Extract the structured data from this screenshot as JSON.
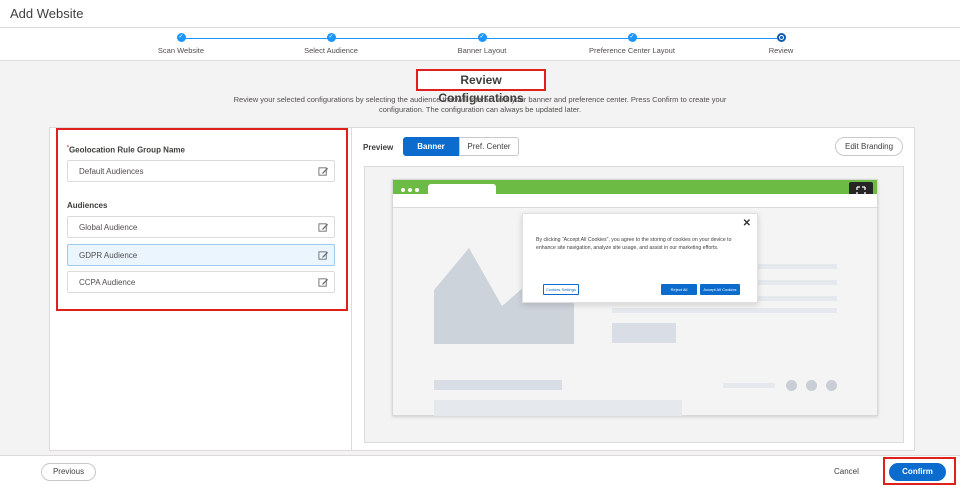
{
  "window": {
    "title": "Add Website"
  },
  "stepper": {
    "steps": [
      {
        "label": "Scan Website",
        "state": "complete"
      },
      {
        "label": "Select Audience",
        "state": "complete"
      },
      {
        "label": "Banner Layout",
        "state": "complete"
      },
      {
        "label": "Preference Center Layout",
        "state": "complete"
      },
      {
        "label": "Review",
        "state": "current"
      }
    ],
    "accent": "#1b96ff"
  },
  "review": {
    "title": "Review Configurations",
    "description": "Review your selected configurations by selecting the audience that will interact with your banner and preference center. Press Confirm to create your configuration. The configuration can always be updated later."
  },
  "left_panel": {
    "required_mark": "*",
    "group_label": "Geolocation Rule Group Name",
    "group_value": "Default Audiences",
    "audiences_label": "Audiences",
    "audiences": [
      {
        "label": "Global Audience",
        "selected": false
      },
      {
        "label": "GDPR Audience",
        "selected": true
      },
      {
        "label": "CCPA Audience",
        "selected": false
      }
    ],
    "edit_icon": "edit-icon"
  },
  "preview": {
    "label": "Preview",
    "tabs": [
      {
        "label": "Banner",
        "active": true
      },
      {
        "label": "Pref. Center",
        "active": false
      }
    ],
    "edit_branding": "Edit Branding",
    "browser_bar_color": "#6cbb45",
    "banner": {
      "close": "✕",
      "text": "By clicking “Accept All Cookies”, you agree to the storing of cookies on your device to enhance site navigation, analyze site usage, and assist in our marketing efforts.",
      "settings_button": "Cookies Settings",
      "reject_button": "Reject All",
      "accept_button": "Accept All Cookies"
    }
  },
  "footer": {
    "previous": "Previous",
    "cancel": "Cancel",
    "confirm": "Confirm",
    "primary_color": "#0b6cce"
  }
}
